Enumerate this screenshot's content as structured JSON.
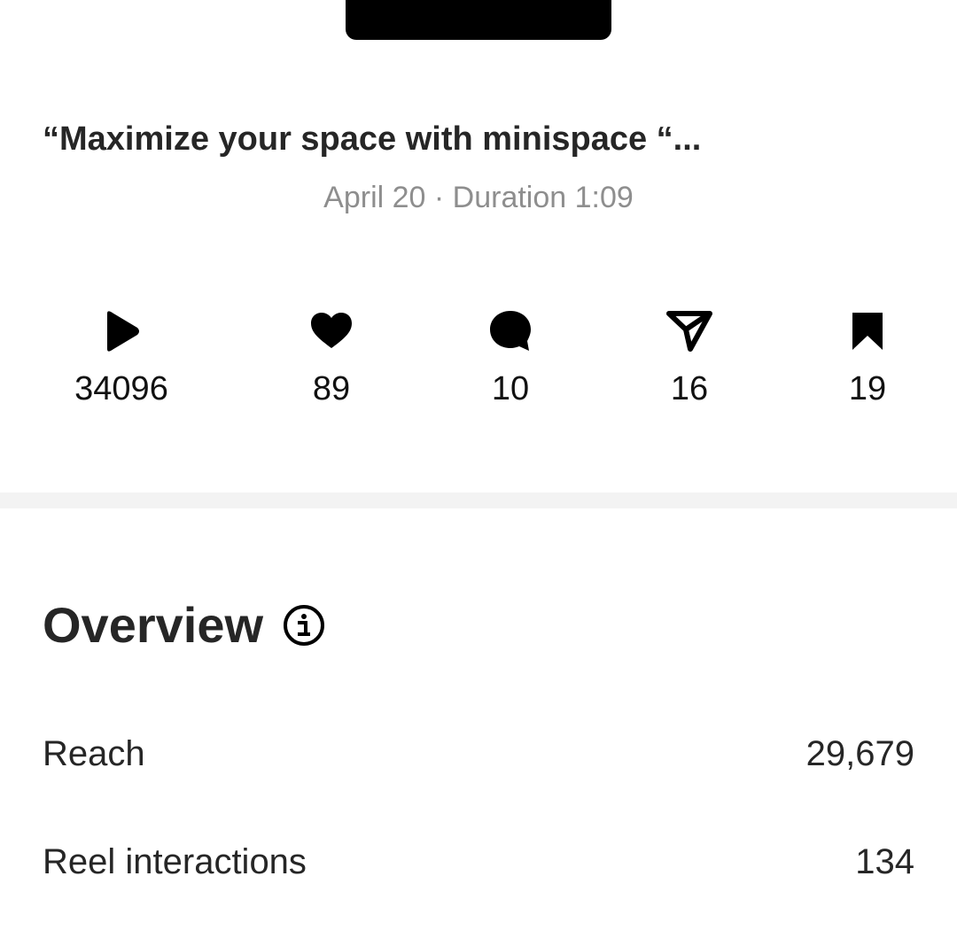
{
  "post": {
    "caption": "“Maximize your space with minispace “...",
    "meta": "April 20 · Duration 1:09"
  },
  "stats": [
    {
      "icon": "play-icon",
      "value": "34096"
    },
    {
      "icon": "heart-icon",
      "value": "89"
    },
    {
      "icon": "comment-icon",
      "value": "10"
    },
    {
      "icon": "share-icon",
      "value": "16"
    },
    {
      "icon": "bookmark-icon",
      "value": "19"
    }
  ],
  "overview": {
    "title": "Overview",
    "info_icon": "info-icon",
    "rows": [
      {
        "label": "Reach",
        "value": "29,679"
      },
      {
        "label": "Reel interactions",
        "value": "134"
      }
    ]
  },
  "colors": {
    "text": "#262626",
    "muted": "#8e8e8e",
    "divider": "#f3f3f3"
  }
}
